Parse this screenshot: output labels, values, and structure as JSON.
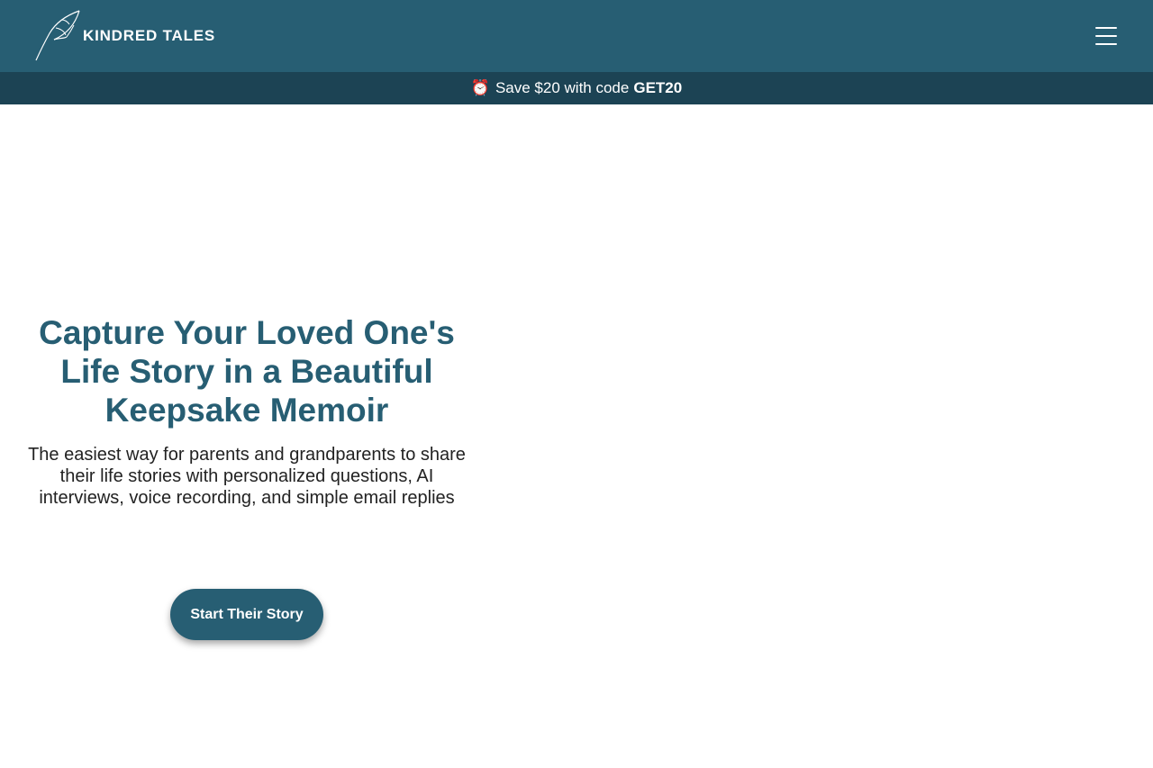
{
  "header": {
    "brand_name": "KINDRED TALES",
    "logo_icon": "quill-feather-icon",
    "menu_icon": "hamburger-menu-icon"
  },
  "promo": {
    "icon": "alarm-clock-icon",
    "alarm_glyph": "⏰",
    "text": "Save $20 with code",
    "code": "GET20"
  },
  "hero": {
    "title": "Capture Your Loved One's Life Story in a Beautiful Keepsake Memoir",
    "subtitle": "The easiest way for parents and grandparents to share their life stories with personalized questions, AI interviews, voice recording,  and simple email replies",
    "cta_label": "Start Their Story"
  },
  "colors": {
    "header_bg": "#275e73",
    "promo_bg": "#1c4354",
    "accent": "#275e73",
    "body_text": "#222222"
  }
}
